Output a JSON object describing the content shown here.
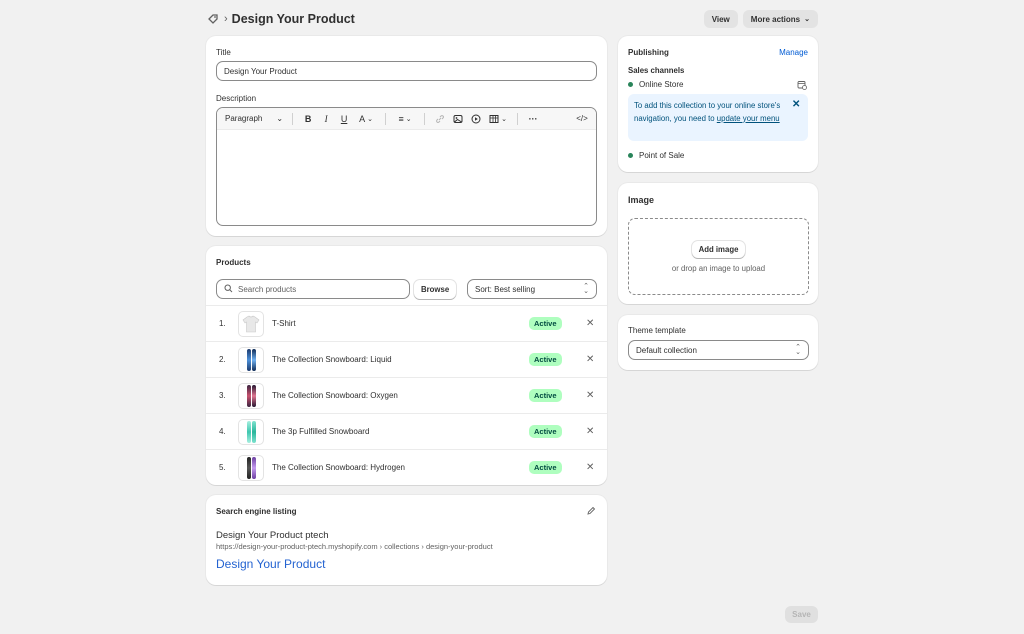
{
  "header": {
    "title": "Design Your Product",
    "view_label": "View",
    "more_actions_label": "More actions",
    "breadcrumb_icon": "collection-tag-icon"
  },
  "title_card": {
    "title_label": "Title",
    "title_value": "Design Your Product",
    "description_label": "Description",
    "toolbar": {
      "paragraph_label": "Paragraph",
      "icons": [
        "bold-icon",
        "italic-icon",
        "underline-icon",
        "text-color-icon",
        "align-icon",
        "link-icon",
        "image-icon",
        "video-icon",
        "table-icon",
        "more-icon",
        "code-icon"
      ]
    }
  },
  "products": {
    "heading": "Products",
    "search_placeholder": "Search products",
    "browse_label": "Browse",
    "sort_label": "Sort: Best selling",
    "rows": [
      {
        "num": "1.",
        "name": "T-Shirt",
        "status": "Active"
      },
      {
        "num": "2.",
        "name": "The Collection Snowboard: Liquid",
        "status": "Active"
      },
      {
        "num": "3.",
        "name": "The Collection Snowboard: Oxygen",
        "status": "Active"
      },
      {
        "num": "4.",
        "name": "The 3p Fulfilled Snowboard",
        "status": "Active"
      },
      {
        "num": "5.",
        "name": "The Collection Snowboard: Hydrogen",
        "status": "Active"
      }
    ]
  },
  "seo": {
    "heading": "Search engine listing",
    "page_title": "Design Your Product ptech",
    "url": "https://design-your-product-ptech.myshopify.com › collections › design-your-product",
    "link_title": "Design Your Product"
  },
  "publishing": {
    "heading": "Publishing",
    "manage_label": "Manage",
    "sales_channels_label": "Sales channels",
    "online_store_label": "Online Store",
    "banner_text": "To add this collection to your online store's navigation, you need to ",
    "banner_link": "update your menu",
    "pos_label": "Point of Sale"
  },
  "image_card": {
    "heading": "Image",
    "add_image_label": "Add image",
    "drop_text": "or drop an image to upload"
  },
  "theme": {
    "label": "Theme template",
    "value": "Default collection"
  },
  "save_label": "Save",
  "colors": {
    "accent": "#005bd3",
    "badge_bg": "#affebf",
    "badge_text": "#014b40",
    "banner_bg": "#eaf4ff",
    "dot": "#29845a"
  }
}
